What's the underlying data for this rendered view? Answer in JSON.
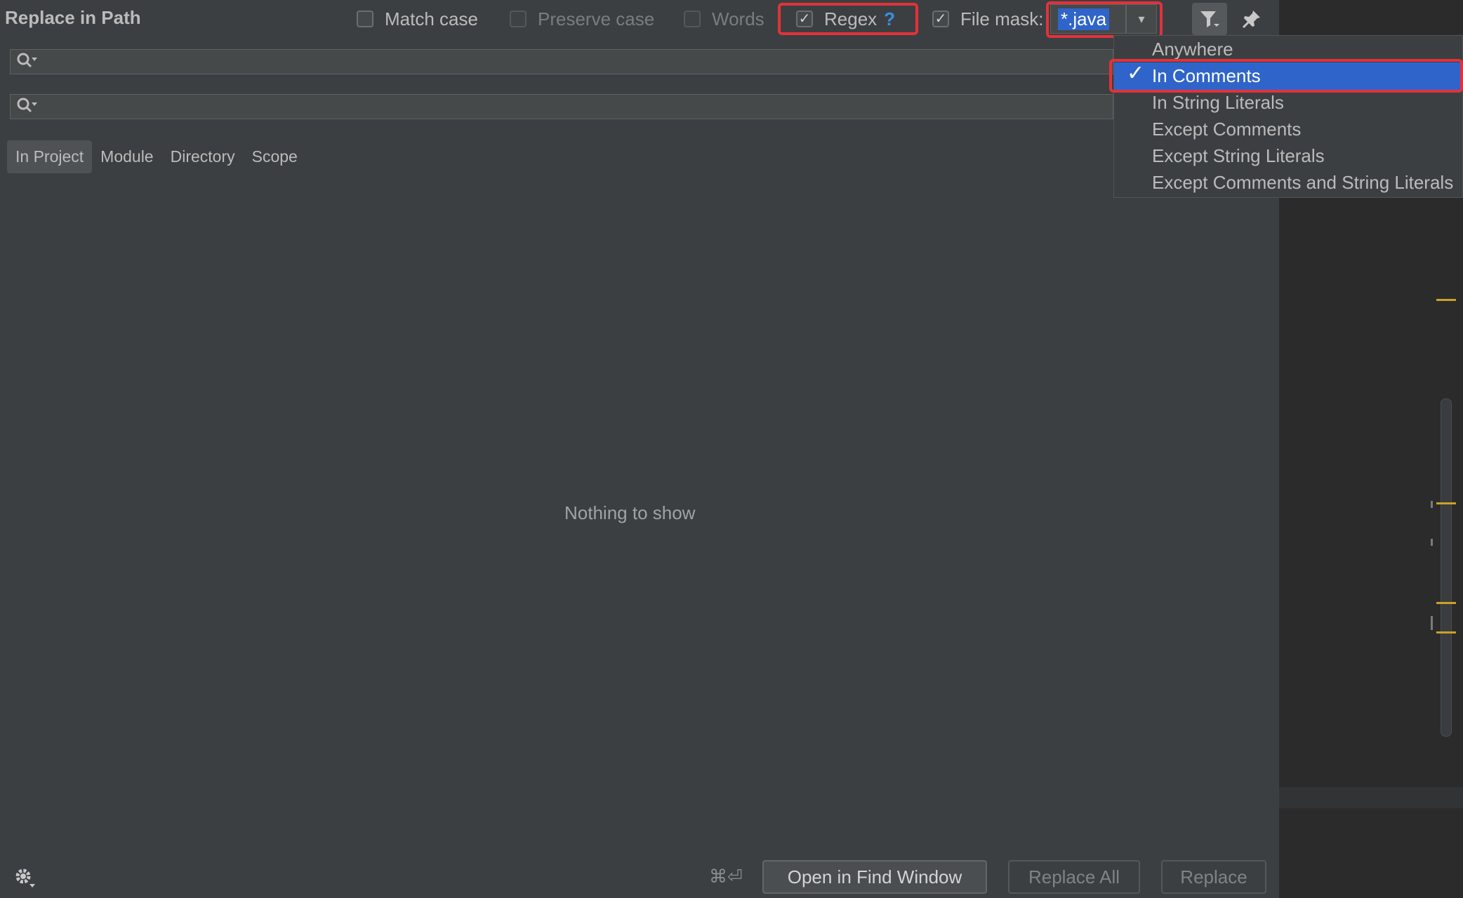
{
  "window": {
    "title": "Replace in Path"
  },
  "options": {
    "match_case": {
      "label": "Match case",
      "checked": false
    },
    "preserve_case": {
      "label": "Preserve case",
      "checked": false
    },
    "words": {
      "label": "Words",
      "checked": false
    },
    "regex": {
      "label": "Regex",
      "checked": true,
      "help": "?"
    },
    "file_mask": {
      "label": "File mask:",
      "checked": true,
      "value": "*.java"
    }
  },
  "search": {
    "find_value": "",
    "replace_value": ""
  },
  "scope_tabs": [
    {
      "label": "In Project",
      "active": true
    },
    {
      "label": "Module",
      "active": false
    },
    {
      "label": "Directory",
      "active": false
    },
    {
      "label": "Scope",
      "active": false
    }
  ],
  "results": {
    "empty_text": "Nothing to show"
  },
  "context_menu": {
    "items": [
      {
        "label": "Anywhere",
        "selected": false
      },
      {
        "label": "In Comments",
        "selected": true
      },
      {
        "label": "In String Literals",
        "selected": false
      },
      {
        "label": "Except Comments",
        "selected": false
      },
      {
        "label": "Except String Literals",
        "selected": false
      },
      {
        "label": "Except Comments and String Literals",
        "selected": false
      }
    ]
  },
  "footer": {
    "shortcut": "⌘⏎",
    "open_in_find_window": "Open in Find Window",
    "replace_all": "Replace All",
    "replace": "Replace"
  },
  "icons": {
    "check": "✓",
    "search": "🔍",
    "dropdown": "▾",
    "filter": "filter-icon",
    "pin": "pin-icon",
    "settings": "gear-icon"
  },
  "colors": {
    "background": "#3c3f41",
    "highlight": "#2f65ca",
    "annotation": "#e2323b",
    "text": "#bbbbbb"
  }
}
